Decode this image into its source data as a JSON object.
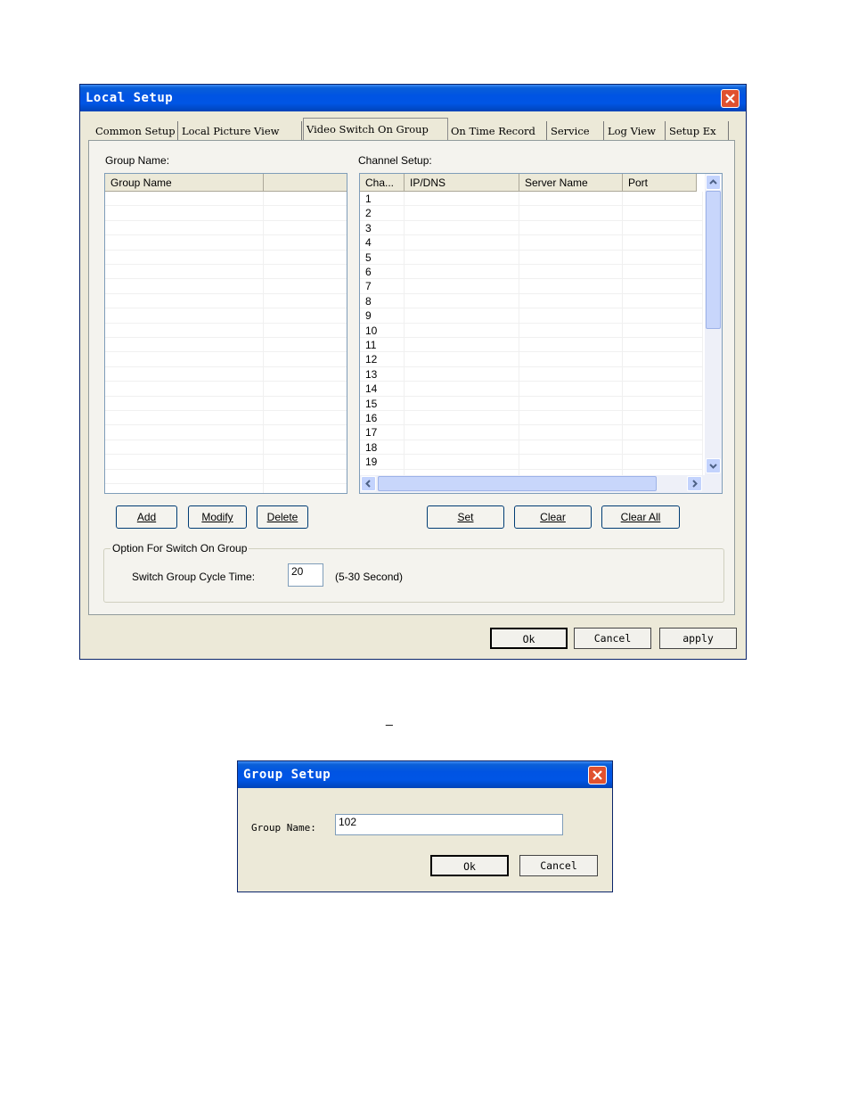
{
  "local_setup": {
    "title": "Local Setup",
    "tabs": [
      "Common Setup",
      "Local Picture View",
      "Video Switch On Group",
      "On Time Record",
      "Service",
      "Log View",
      "Setup Ex"
    ],
    "active_tab": "Video Switch On Group",
    "group_name_label": "Group Name:",
    "group_list_header": "Group Name",
    "channel_setup_label": "Channel Setup:",
    "channel_headers": [
      "Cha...",
      "IP/DNS",
      "Server Name",
      "Port"
    ],
    "channels": [
      "1",
      "2",
      "3",
      "4",
      "5",
      "6",
      "7",
      "8",
      "9",
      "10",
      "11",
      "12",
      "13",
      "14",
      "15",
      "16",
      "17",
      "18",
      "19"
    ],
    "buttons": {
      "add": "Add",
      "modify": "Modify",
      "delete": "Delete",
      "set": "Set",
      "clear": "Clear",
      "clear_all": "Clear All"
    },
    "option_group_label": "Option For Switch On Group",
    "cycle_time_label": "Switch Group Cycle Time:",
    "cycle_time_value": "20",
    "cycle_time_range": "(5-30 Second)",
    "footer_buttons": {
      "ok": "Ok",
      "cancel": "Cancel",
      "apply": "apply"
    }
  },
  "separator_mark": "_",
  "group_setup": {
    "title": "Group Setup",
    "group_name_label": "Group Name:",
    "group_name_value": "102",
    "ok": "Ok",
    "cancel": "Cancel"
  },
  "colors": {
    "title_bar": "#0054e3",
    "dialog_bg": "#ece9d8",
    "close_button": "#e0512f",
    "scrollbar": "#c3d3fd"
  }
}
